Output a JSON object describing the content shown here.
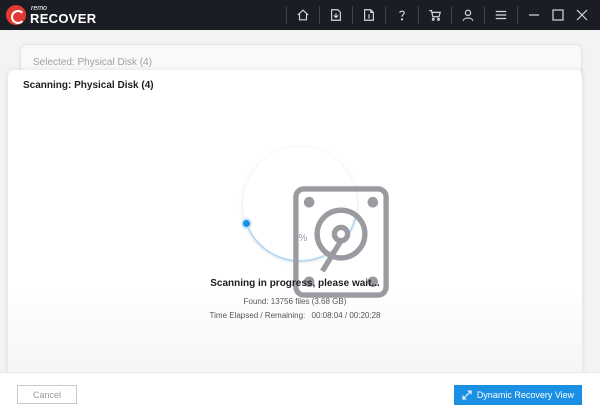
{
  "app": {
    "logo_small": "remo",
    "logo_big": "RECOVER"
  },
  "toolbar": {
    "icons": [
      "home-icon",
      "open-file-icon",
      "save-file-icon",
      "help-icon",
      "cart-icon",
      "user-icon",
      "menu-icon"
    ],
    "window": [
      "minimize-icon",
      "maximize-icon",
      "close-icon"
    ]
  },
  "selected_card": {
    "label": "Selected: Physical Disk (4)"
  },
  "scan": {
    "title": "Scanning: Physical Disk (4)",
    "progress_percent": 1,
    "progress_label": "1%",
    "status": "Scanning in progress, please wait...",
    "found": "Found: 13756 files (3.68 GB)",
    "elapsed_label": "Time Elapsed / Remaining:",
    "elapsed_value": "00:08:04 / 00:20:28"
  },
  "footer": {
    "cancel_label": "Cancel",
    "dynamic_label": "Dynamic Recovery View"
  },
  "colors": {
    "titlebar": "#1b1d24",
    "accent": "#1a8fe3",
    "logo_red": "#e23a31"
  }
}
